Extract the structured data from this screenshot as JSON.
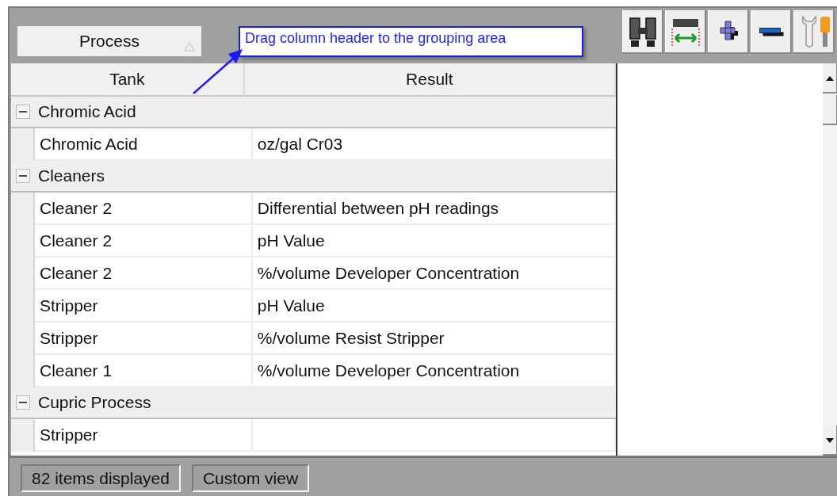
{
  "grouping_area": {
    "group_by": [
      {
        "label": "Process"
      }
    ],
    "hint": "Drag column header to the grouping area"
  },
  "table": {
    "columns": [
      "Tank",
      "Result"
    ],
    "groups": [
      {
        "label": "Chromic Acid",
        "expanded": true,
        "rows": [
          {
            "tank": "Chromic Acid",
            "result": "oz/gal Cr03"
          }
        ]
      },
      {
        "label": "Cleaners",
        "expanded": true,
        "rows": [
          {
            "tank": "Cleaner 2",
            "result": "Differential between pH readings"
          },
          {
            "tank": "Cleaner 2",
            "result": "pH Value"
          },
          {
            "tank": "Cleaner 2",
            "result": "%/volume Developer Concentration"
          },
          {
            "tank": "Stripper",
            "result": "pH Value"
          },
          {
            "tank": "Stripper",
            "result": "%/volume Resist Stripper"
          },
          {
            "tank": "Cleaner 1",
            "result": "%/volume Developer Concentration"
          }
        ]
      },
      {
        "label": "Cupric Process",
        "expanded": true,
        "rows": [
          {
            "tank": "Stripper",
            "result": ""
          }
        ]
      }
    ]
  },
  "status_bar": [
    "82 items displayed",
    "Custom view"
  ]
}
